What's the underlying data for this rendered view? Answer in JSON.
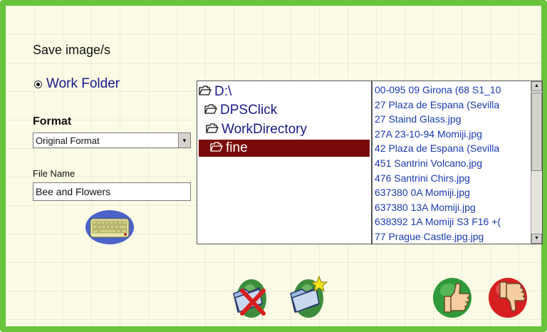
{
  "dialog": {
    "title": "Save image/s",
    "location": {
      "selected_option": "Work Folder"
    },
    "format": {
      "label": "Format",
      "selected": "Original Format"
    },
    "file_name": {
      "label": "File Name",
      "value": "Bee and Flowers"
    }
  },
  "folder_tree": {
    "items": [
      {
        "label": "D:\\",
        "icon": "folder-open-icon"
      },
      {
        "label": "DPSClick",
        "icon": "folder-open-icon"
      },
      {
        "label": "WorkDirectory",
        "icon": "folder-open-icon"
      },
      {
        "label": "fine",
        "icon": "folder-open-icon",
        "selected": true
      }
    ]
  },
  "file_list": {
    "items": [
      "00-095 09 Girona (68 S1_10",
      "27 Plaza de Espana (Sevilla",
      "27 Staind Glass.jpg",
      "27A 23-10-94 Momiji.jpg",
      "42 Plaza de Espana (Sevilla",
      "451 Santrini Volcano.jpg",
      "476 Santrini Chirs.jpg",
      "637380 0A Momiji.jpg",
      "637380 13A Momiji.jpg",
      "638392 1A Momiji S3 F16 +(",
      "77 Prague Castle.jpg.jpg"
    ]
  },
  "actions": {
    "cancel_folder_icon": "folder-x-icon",
    "new_folder_icon": "folder-star-icon",
    "confirm_icon": "thumbs-up-icon",
    "reject_icon": "thumbs-down-icon"
  },
  "colors": {
    "frame_border": "#69c43c",
    "background": "#fbfbe6",
    "selection": "#7a0a0a",
    "link_text": "#1a1a8c",
    "confirm": "#2f9a3a",
    "reject": "#d62020"
  }
}
